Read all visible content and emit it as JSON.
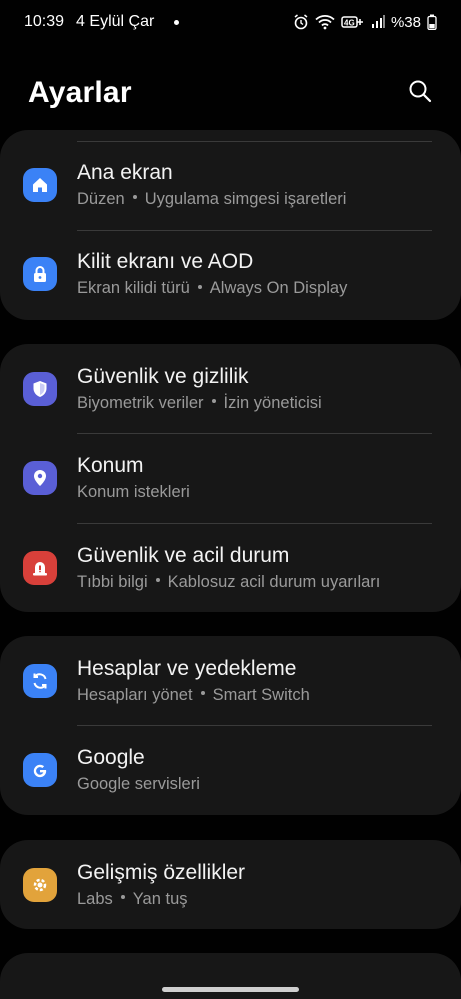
{
  "status_bar": {
    "time": "10:39",
    "date": "4 Eylül Çar",
    "battery": "%38",
    "icons": [
      "alarm-icon",
      "wifi-icon",
      "volte-icon",
      "signal-icon",
      "battery-icon"
    ]
  },
  "header": {
    "title": "Ayarlar",
    "search_icon": "search-icon"
  },
  "groups": [
    {
      "items": [
        {
          "title": "Ana ekran",
          "subtitle": [
            "Düzen",
            "Uygulama simgesi işaretleri"
          ],
          "icon": "home-icon",
          "color": "#3b82f6"
        },
        {
          "title": "Kilit ekranı ve AOD",
          "subtitle": [
            "Ekran kilidi türü",
            "Always On Display"
          ],
          "icon": "lock-icon",
          "color": "#3b82f6"
        }
      ]
    },
    {
      "items": [
        {
          "title": "Güvenlik ve gizlilik",
          "subtitle": [
            "Biyometrik veriler",
            "İzin yöneticisi"
          ],
          "icon": "shield-icon",
          "color": "#5a5fd6"
        },
        {
          "title": "Konum",
          "subtitle": [
            "Konum istekleri"
          ],
          "icon": "location-pin-icon",
          "color": "#5a5fd6"
        },
        {
          "title": "Güvenlik ve acil durum",
          "subtitle": [
            "Tıbbi bilgi",
            "Kablosuz acil durum uyarıları"
          ],
          "icon": "emergency-icon",
          "color": "#d8403a"
        }
      ]
    },
    {
      "items": [
        {
          "title": "Hesaplar ve yedekleme",
          "subtitle": [
            "Hesapları yönet",
            "Smart Switch"
          ],
          "icon": "sync-icon",
          "color": "#3b82f6"
        },
        {
          "title": "Google",
          "subtitle": [
            "Google servisleri"
          ],
          "icon": "google-icon",
          "color": "#3b82f6"
        }
      ]
    },
    {
      "items": [
        {
          "title": "Gelişmiş özellikler",
          "subtitle": [
            "Labs",
            "Yan tuş"
          ],
          "icon": "gear-plus-icon",
          "color": "#e2a33b"
        }
      ]
    }
  ]
}
